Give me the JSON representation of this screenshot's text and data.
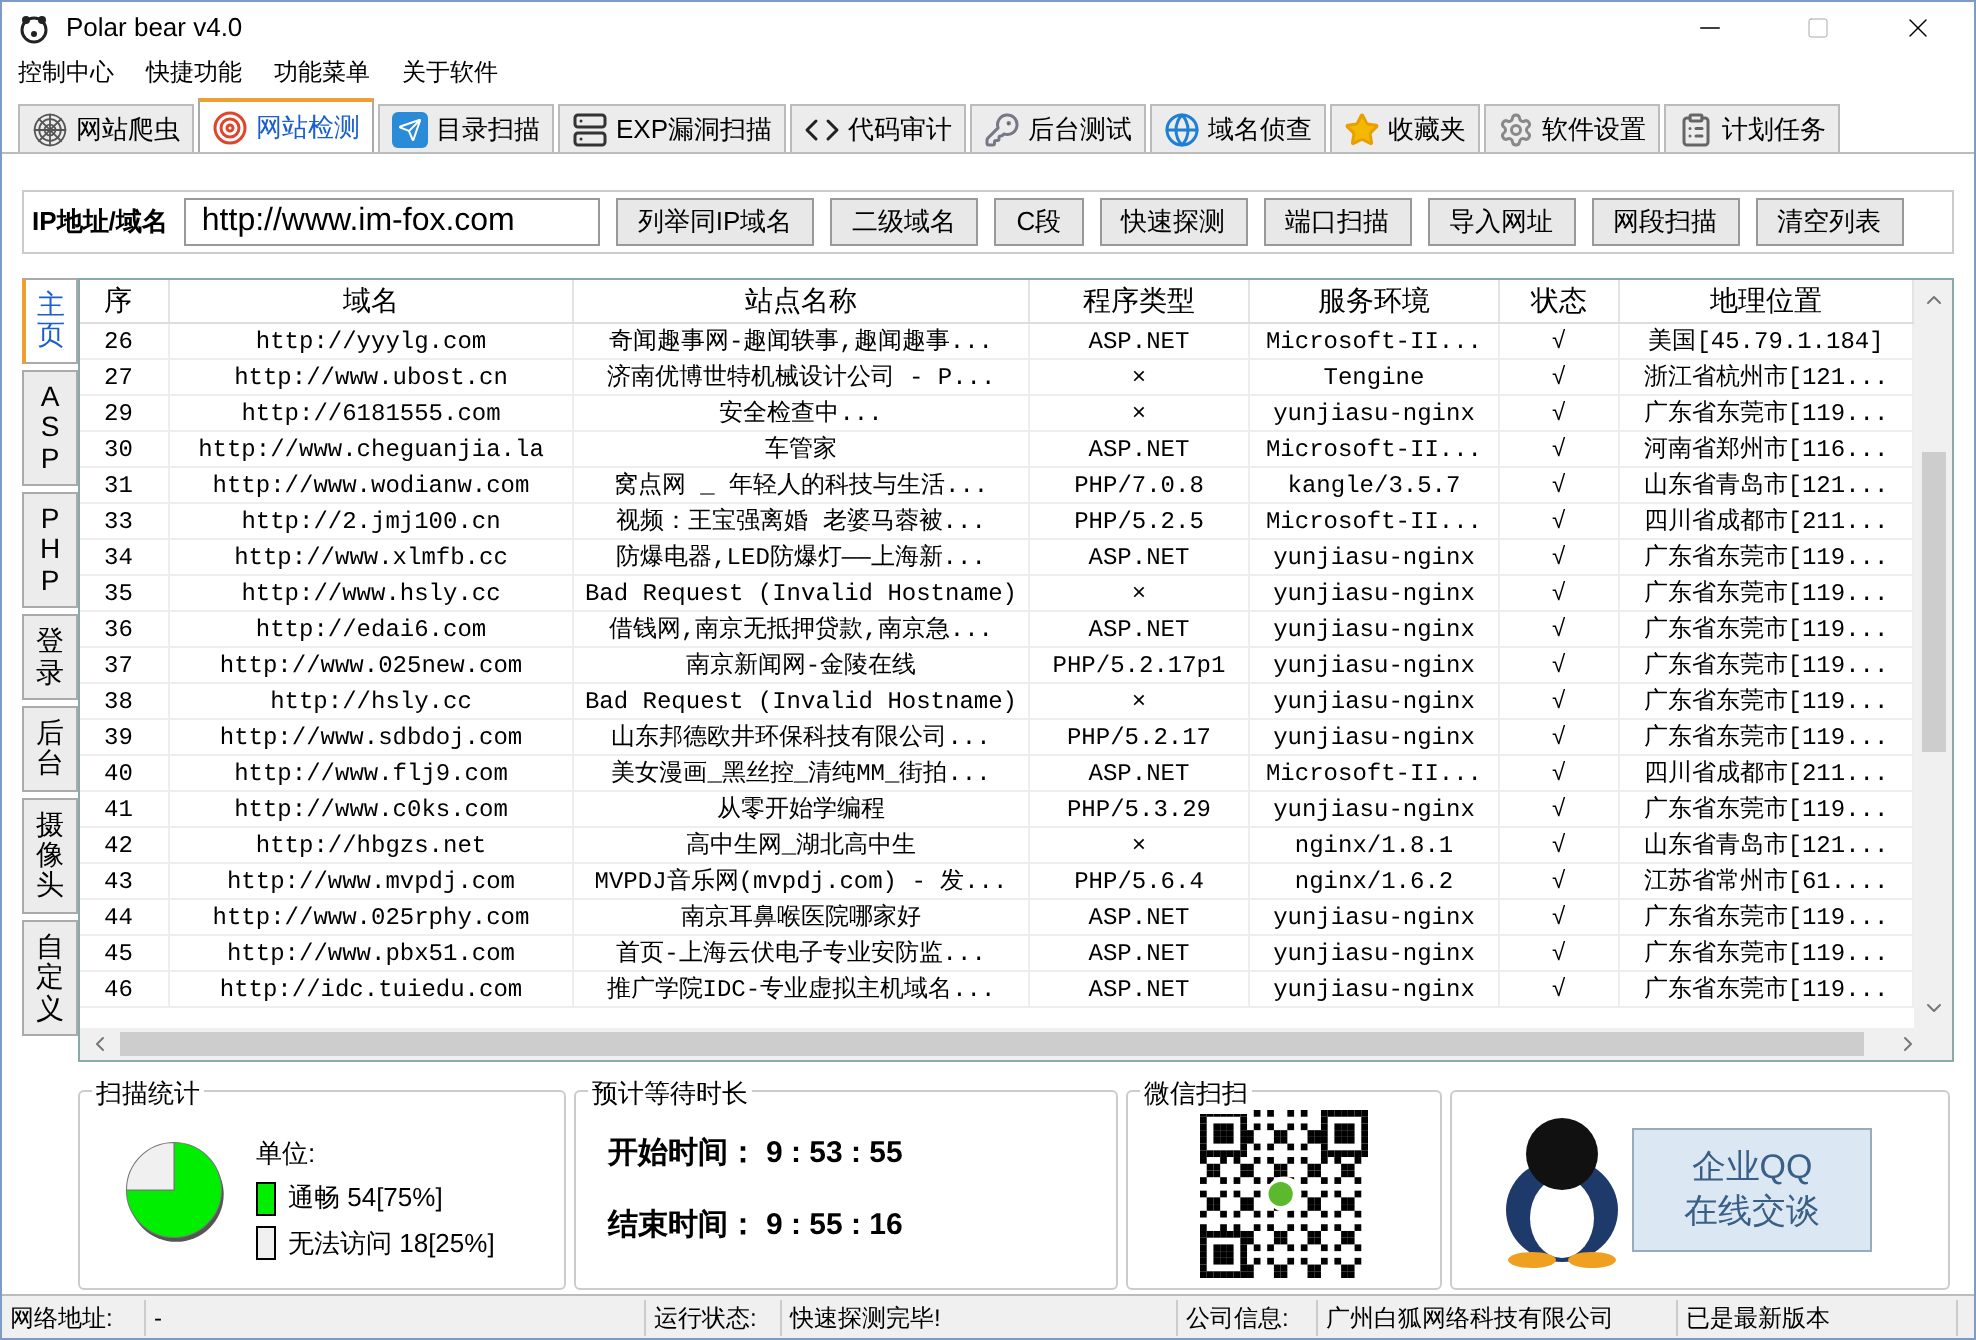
{
  "window": {
    "title": "Polar bear v4.0"
  },
  "menu": [
    "控制中心",
    "快捷功能",
    "功能菜单",
    "关于软件"
  ],
  "tabs": [
    {
      "label": "网站爬虫",
      "selected": false
    },
    {
      "label": "网站检测",
      "selected": true
    },
    {
      "label": "目录扫描",
      "selected": false
    },
    {
      "label": "EXP漏洞扫描",
      "selected": false
    },
    {
      "label": "代码审计",
      "selected": false
    },
    {
      "label": "后台测试",
      "selected": false
    },
    {
      "label": "域名侦查",
      "selected": false
    },
    {
      "label": "收藏夹",
      "selected": false
    },
    {
      "label": "软件设置",
      "selected": false
    },
    {
      "label": "计划任务",
      "selected": false
    }
  ],
  "toolbar": {
    "label": "IP地址/域名",
    "value": "http://www.im-fox.com",
    "buttons": [
      "列举同IP域名",
      "二级域名",
      "C段",
      "快速探测",
      "端口扫描",
      "导入网址",
      "网段扫描",
      "清空列表"
    ]
  },
  "side_tabs": [
    {
      "label": "主页",
      "selected": true
    },
    {
      "label": "ASP",
      "selected": false
    },
    {
      "label": "PHP",
      "selected": false
    },
    {
      "label": "登录",
      "selected": false
    },
    {
      "label": "后台",
      "selected": false
    },
    {
      "label": "摄像头",
      "selected": false
    },
    {
      "label": "自定义",
      "selected": false
    }
  ],
  "table": {
    "columns": [
      "序",
      "域名",
      "站点名称",
      "程序类型",
      "服务环境",
      "状态",
      "地理位置"
    ],
    "rows": [
      [
        "26",
        "http://yyylg.com",
        "奇闻趣事网-趣闻轶事,趣闻趣事...",
        "ASP.NET",
        "Microsoft-II...",
        "√",
        "美国[45.79.1.184]"
      ],
      [
        "27",
        "http://www.ubost.cn",
        "济南优博世特机械设计公司 - P...",
        "×",
        "Tengine",
        "√",
        "浙江省杭州市[121..."
      ],
      [
        "29",
        "http://6181555.com",
        "安全检查中...",
        "×",
        "yunjiasu-nginx",
        "√",
        "广东省东莞市[119..."
      ],
      [
        "30",
        "http://www.cheguanjia.la",
        "车管家",
        "ASP.NET",
        "Microsoft-II...",
        "√",
        "河南省郑州市[116..."
      ],
      [
        "31",
        "http://www.wodianw.com",
        "窝点网 _  年轻人的科技与生活...",
        "PHP/7.0.8",
        "kangle/3.5.7",
        "√",
        "山东省青岛市[121..."
      ],
      [
        "33",
        "http://2.jmj100.cn",
        "视频：王宝强离婚 老婆马蓉被...",
        "PHP/5.2.5",
        "Microsoft-II...",
        "√",
        "四川省成都市[211..."
      ],
      [
        "34",
        "http://www.xlmfb.cc",
        "防爆电器,LED防爆灯——上海新...",
        "ASP.NET",
        "yunjiasu-nginx",
        "√",
        "广东省东莞市[119..."
      ],
      [
        "35",
        "http://www.hsly.cc",
        "Bad Request (Invalid Hostname)",
        "×",
        "yunjiasu-nginx",
        "√",
        "广东省东莞市[119..."
      ],
      [
        "36",
        "http://edai6.com",
        "借钱网,南京无抵押贷款,南京急...",
        "ASP.NET",
        "yunjiasu-nginx",
        "√",
        "广东省东莞市[119..."
      ],
      [
        "37",
        "http://www.025new.com",
        "南京新闻网-金陵在线",
        "PHP/5.2.17p1",
        "yunjiasu-nginx",
        "√",
        "广东省东莞市[119..."
      ],
      [
        "38",
        "http://hsly.cc",
        "Bad Request (Invalid Hostname)",
        "×",
        "yunjiasu-nginx",
        "√",
        "广东省东莞市[119..."
      ],
      [
        "39",
        "http://www.sdbdoj.com",
        "山东邦德欧井环保科技有限公司...",
        "PHP/5.2.17",
        "yunjiasu-nginx",
        "√",
        "广东省东莞市[119..."
      ],
      [
        "40",
        "http://www.flj9.com",
        "美女漫画_黑丝控_清纯MM_街拍...",
        "ASP.NET",
        "Microsoft-II...",
        "√",
        "四川省成都市[211..."
      ],
      [
        "41",
        "http://www.c0ks.com",
        "从零开始学编程",
        "PHP/5.3.29",
        "yunjiasu-nginx",
        "√",
        "广东省东莞市[119..."
      ],
      [
        "42",
        "http://hbgzs.net",
        "高中生网_湖北高中生",
        "×",
        "nginx/1.8.1",
        "√",
        "山东省青岛市[121..."
      ],
      [
        "43",
        "http://www.mvpdj.com",
        "MVPDJ音乐网(mvpdj.com) - 发...",
        "PHP/5.6.4",
        "nginx/1.6.2",
        "√",
        "江苏省常州市[61...."
      ],
      [
        "44",
        "http://www.025rphy.com",
        "南京耳鼻喉医院哪家好",
        "ASP.NET",
        "yunjiasu-nginx",
        "√",
        "广东省东莞市[119..."
      ],
      [
        "45",
        "http://www.pbx51.com",
        "首页-上海云伏电子专业安防监...",
        "ASP.NET",
        "yunjiasu-nginx",
        "√",
        "广东省东莞市[119..."
      ],
      [
        "46",
        "http://idc.tuiedu.com",
        "推广学院IDC-专业虚拟主机域名...",
        "ASP.NET",
        "yunjiasu-nginx",
        "√",
        "广东省东莞市[119..."
      ]
    ]
  },
  "scan_stats": {
    "title": "扫描统计",
    "unit": "单位:",
    "chart_data": {
      "type": "pie",
      "values": [
        75,
        25
      ]
    },
    "legend": [
      {
        "label": "通畅 54[75%]",
        "color": "#00ee00"
      },
      {
        "label": "无法访问 18[25%]",
        "color": "#f0f0f0"
      }
    ]
  },
  "wait_time": {
    "title": "预计等待时长",
    "rows": [
      {
        "label": "开始时间：",
        "value": "9 : 53 : 55"
      },
      {
        "label": "结束时间：",
        "value": "9 : 55 : 16"
      }
    ]
  },
  "wechat": {
    "title": "微信扫扫"
  },
  "qq": {
    "lines": [
      "企业QQ",
      "在线交谈"
    ]
  },
  "status_bar": [
    "网络地址:",
    "-",
    "运行状态:",
    "快速探测完毕!",
    "公司信息:",
    "广州白狐网络科技有限公司",
    "已是最新版本"
  ]
}
